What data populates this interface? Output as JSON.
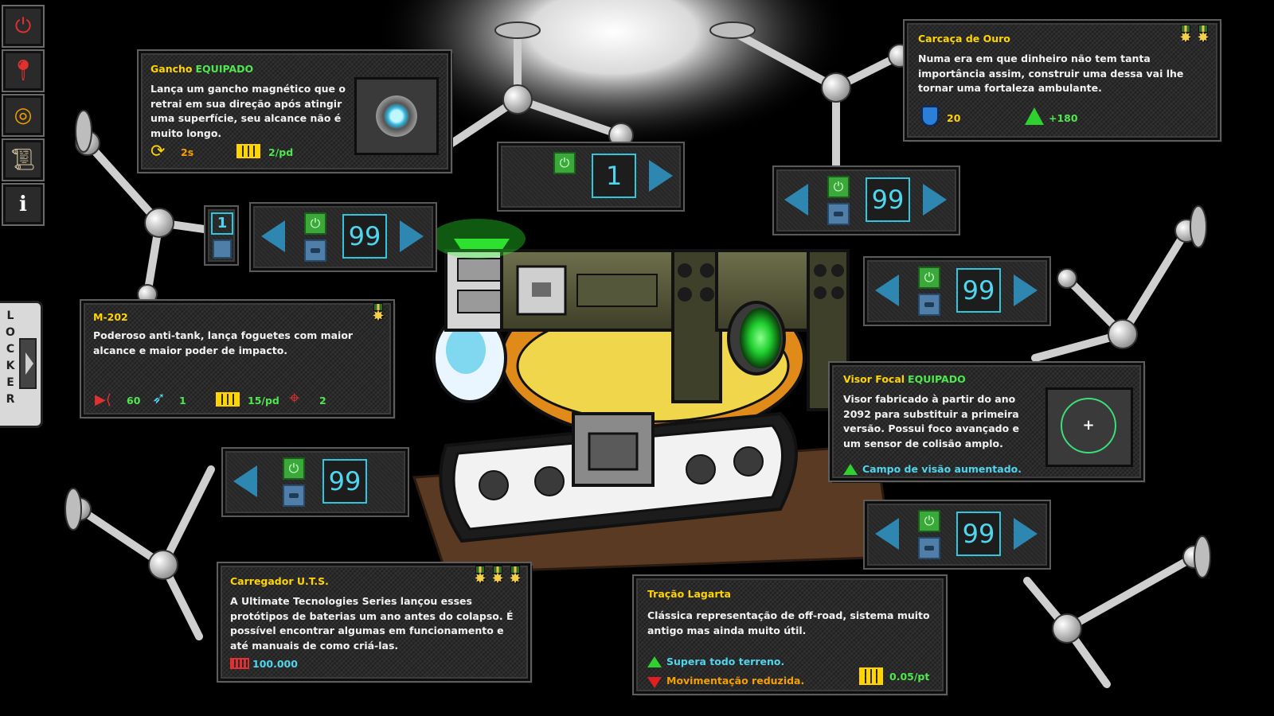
{
  "menu": {
    "icons": [
      "power-icon",
      "map-pin-icon",
      "target-icon",
      "scroll-icon",
      "info-icon"
    ],
    "locker_label": "LOCKER"
  },
  "gancho": {
    "title": "Gancho",
    "status": "EQUIPADO",
    "description": "Lança um gancho magnético que o retrai em sua direção após atingir uma superfície, seu alcance não é muito longo.",
    "cooldown": "2s",
    "energy": "2/pd"
  },
  "carcaca": {
    "title": "Carcaça de Ouro",
    "description": "Numa era em que dinheiro não tem tanta importância assim, construir uma dessa vai lhe tornar uma fortaleza ambulante.",
    "armor": "20",
    "health": "+180",
    "medal_count": 2
  },
  "m202": {
    "title": "M-202",
    "description": "Poderoso anti-tank, lança foguetes com maior alcance e maior poder de impacto.",
    "damage": "60",
    "ammo": "1",
    "energy": "15/pd",
    "precision": "2",
    "medal_count": 1
  },
  "visor": {
    "title": "Visor Focal",
    "status": "EQUIPADO",
    "description": "Visor fabricado à partir do ano 2092 para substituir a primeira versão. Possui foco avançado e um sensor de colisão amplo.",
    "perk": "Campo de visão aumentado."
  },
  "carregador": {
    "title": "Carregador U.T.S.",
    "description": "A Ultimate Tecnologies Series lançou esses protótipos de baterias um ano antes do colapso. É possível encontrar algumas em funcionamento e até manuais de como criá-las.",
    "price": "100.000",
    "medal_count": 3
  },
  "tracao": {
    "title": "Tração Lagarta",
    "description": "Clássica representação de off-road, sistema muito antigo mas ainda muito útil.",
    "pro": "Supera todo terreno.",
    "con": "Movimentação reduzida.",
    "energy": "0.05/pt"
  },
  "selectors": {
    "top_center": "1",
    "gancho": "99",
    "gancho_mini": "1",
    "carcaca": "99",
    "m202": "99",
    "right_mid": "99",
    "carregador": "99",
    "tracao": "99"
  },
  "colors": {
    "title": "#ffd400",
    "equipped": "#4ee84e",
    "accent_cyan": "#4fd6ee",
    "panel_bg": "#2b2b2b"
  }
}
